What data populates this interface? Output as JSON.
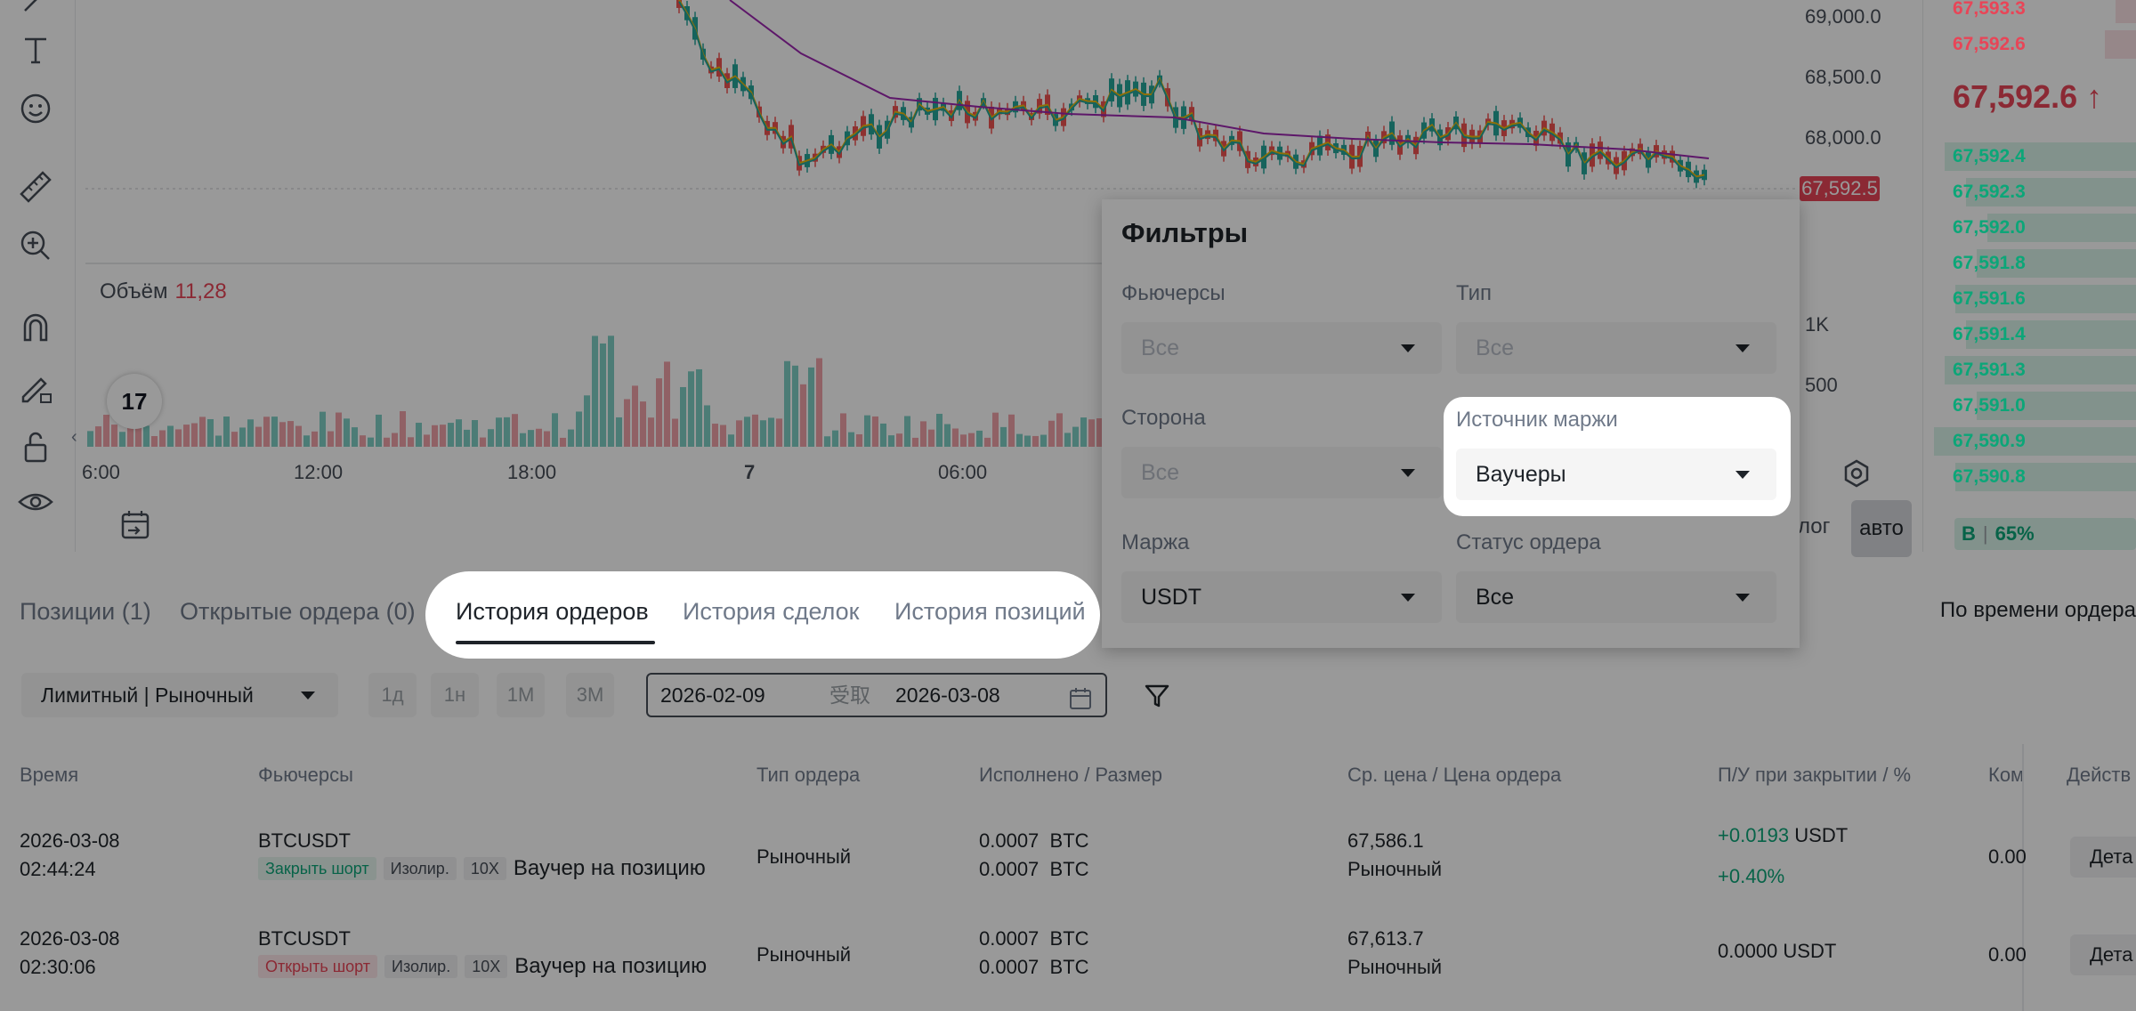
{
  "chart": {
    "price_axis": [
      "69,000.0",
      "68,500.0",
      "68,000.0"
    ],
    "price_tag": "67,592.5",
    "volume_label": "Объём",
    "volume_value": "11,28",
    "volume_axis": [
      "1K",
      "500"
    ],
    "time_axis": [
      "6:00",
      "12:00",
      "18:00",
      "7",
      "06:00"
    ],
    "logo_text": "17",
    "log_label": "лог",
    "auto_label": "авто"
  },
  "orderbook": {
    "asks": [
      {
        "price": "67,593.3",
        "depth": 0.1
      },
      {
        "price": "67,592.6",
        "depth": 0.15
      }
    ],
    "last_price": "67,592.6 ↑",
    "bids": [
      {
        "price": "67,592.4",
        "depth": 0.9
      },
      {
        "price": "67,592.3",
        "depth": 0.8
      },
      {
        "price": "67,592.0",
        "depth": 0.7
      },
      {
        "price": "67,591.8",
        "depth": 0.75
      },
      {
        "price": "67,591.6",
        "depth": 0.85
      },
      {
        "price": "67,591.4",
        "depth": 0.8
      },
      {
        "price": "67,591.3",
        "depth": 0.9
      },
      {
        "price": "67,591.0",
        "depth": 0.75
      },
      {
        "price": "67,590.9",
        "depth": 0.95
      },
      {
        "price": "67,590.8",
        "depth": 0.85
      }
    ],
    "buy_letter": "B",
    "buy_ratio": "65%"
  },
  "tabs": {
    "positions": "Позиции (1)",
    "open_orders": "Открытые ордера (0)",
    "order_history": "История ордеров",
    "trade_history": "История сделок",
    "position_history": "История позиций",
    "sort": "По времени ордера"
  },
  "toolbar": {
    "order_type": "Лимитный | Рыночный",
    "periods": [
      "1д",
      "1н",
      "1М",
      "3М"
    ],
    "date_from": "2026-02-09",
    "date_sep": "受取",
    "date_to": "2026-03-08"
  },
  "table": {
    "headers": {
      "time": "Время",
      "futures": "Фьючерсы",
      "order_type": "Тип ордера",
      "filled": "Исполнено / Размер",
      "avg_price": "Ср. цена / Цена ордера",
      "pnl": "П/У при закрытии / %",
      "fee": "Ком",
      "actions": "Действ"
    },
    "rows": [
      {
        "date": "2026-03-08",
        "time": "02:44:24",
        "symbol": "BTCUSDT",
        "side": "Закрыть шорт",
        "margin": "Изолир.",
        "leverage": "10X",
        "voucher": "Ваучер на позицию",
        "type": "Рыночный",
        "filled": "0.0007  BTC",
        "size": "0.0007  BTC",
        "avg_price": "67,586.1",
        "order_price": "Рыночный",
        "pnl": "+0.0193",
        "pnl_unit": "USDT",
        "pnl_pct": "+0.40%",
        "fee": "0.00",
        "action": "Дета"
      },
      {
        "date": "2026-03-08",
        "time": "02:30:06",
        "symbol": "BTCUSDT",
        "side": "Открыть шорт",
        "margin": "Изолир.",
        "leverage": "10X",
        "voucher": "Ваучер на позицию",
        "type": "Рыночный",
        "filled": "0.0007  BTC",
        "size": "0.0007  BTC",
        "avg_price": "67,613.7",
        "order_price": "Рыночный",
        "pnl": "0.0000",
        "pnl_unit": "USDT",
        "pnl_pct": "",
        "fee": "0.00",
        "action": "Дета"
      }
    ]
  },
  "filters": {
    "title": "Фильтры",
    "futures_label": "Фьючерсы",
    "futures_value": "Все",
    "type_label": "Тип",
    "type_value": "Все",
    "side_label": "Сторона",
    "side_value": "Все",
    "margin_source_label": "Источник маржи",
    "margin_source_value": "Ваучеры",
    "margin_label": "Маржа",
    "margin_value": "USDT",
    "status_label": "Статус ордера",
    "status_value": "Все"
  },
  "colors": {
    "up": "#26a69a",
    "down": "#ef5350",
    "ma_short": "#f0b90b",
    "ma_mid": "#26a69a",
    "ma_long": "#9c27b0"
  }
}
